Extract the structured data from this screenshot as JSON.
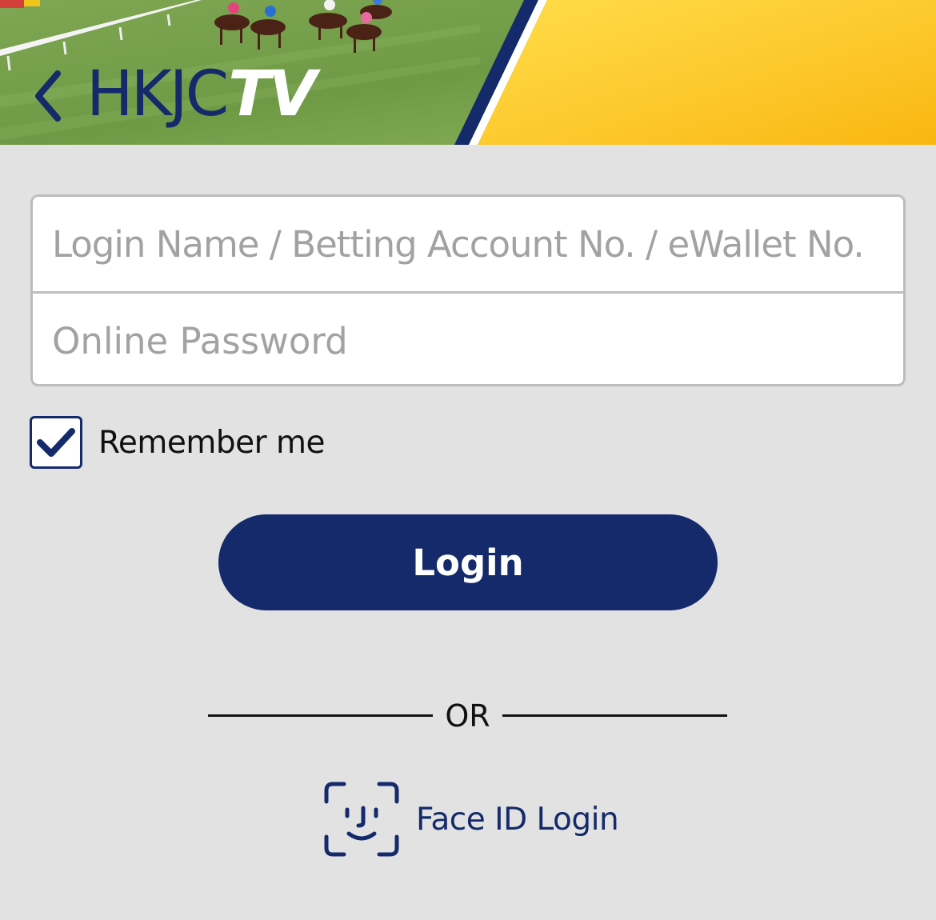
{
  "header": {
    "logo_main": "HKJC",
    "logo_accent": "TV",
    "back_icon": "chevron-left-icon",
    "colors": {
      "navy": "#142a6b",
      "yellow": "#fbbf1a",
      "turf": "#6f9a45"
    }
  },
  "form": {
    "login_placeholder": "Login Name / Betting Account No. / eWallet No.",
    "login_value": "",
    "password_placeholder": "Online Password",
    "password_value": "",
    "remember_label": "Remember me",
    "remember_checked": true,
    "login_button": "Login"
  },
  "divider": {
    "text": "OR"
  },
  "faceid": {
    "label": "Face ID Login",
    "icon": "face-id-icon"
  }
}
